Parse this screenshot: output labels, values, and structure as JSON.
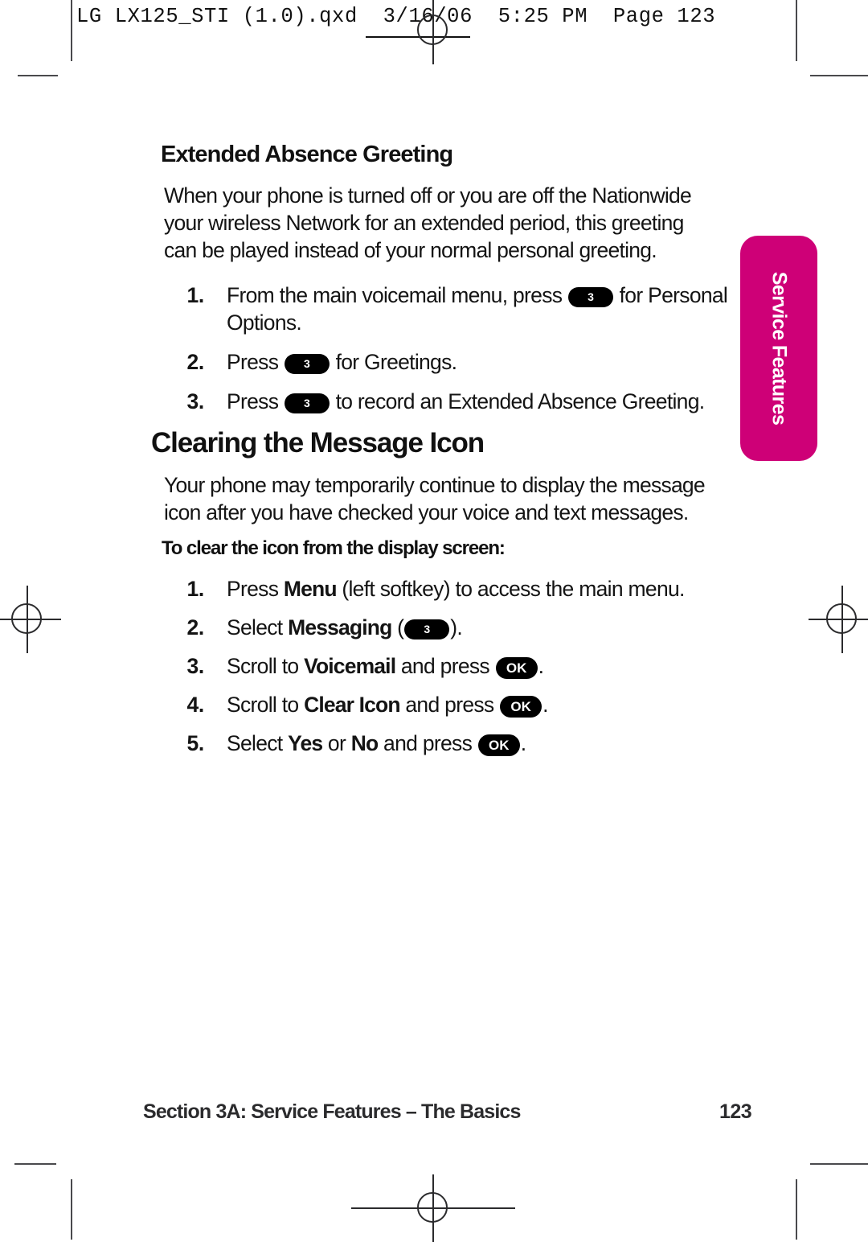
{
  "print_slug": {
    "text": "LG LX125_STI (1.0).qxd  3/16/06  5:25 PM  Page 123"
  },
  "side_tab": {
    "label": "Service Features",
    "color": "#ce0077"
  },
  "sections": [
    {
      "heading": "Extended Absence Greeting",
      "paragraph_lines": [
        "When your phone is turned off or you are off the Nationwide",
        "your wireless Network for an extended period, this greeting",
        "can be played instead of your normal personal greeting."
      ],
      "steps": [
        {
          "number": "1.",
          "pre": "From the main voicemail menu, press ",
          "key": "3",
          "post": " for Personal",
          "continuation": "Options."
        },
        {
          "number": "2.",
          "pre": "Press ",
          "key": "3",
          "post": " for Greetings."
        },
        {
          "number": "3.",
          "pre": "Press ",
          "key": "3",
          "post": " to record an Extended Absence Greeting."
        }
      ]
    },
    {
      "heading": "Clearing the Message Icon",
      "paragraph_lines": [
        "Your phone may temporarily continue to display the message",
        "icon after you have checked your voice and text messages."
      ],
      "subheading": "To clear the icon from the display screen:",
      "steps": [
        {
          "number": "1.",
          "pre": "Press ",
          "bold1": "Menu",
          "post": " (left softkey) to access the main menu."
        },
        {
          "number": "2.",
          "pre": "Select ",
          "bold1": "Messaging",
          "mid": " (",
          "key": "3",
          "post": ")."
        },
        {
          "number": "3.",
          "pre": "Scroll to ",
          "bold1": "Voicemail",
          "mid": " and press ",
          "key": "OK",
          "post": "."
        },
        {
          "number": "4.",
          "pre": "Scroll to ",
          "bold1": "Clear Icon",
          "mid": " and press ",
          "key": "OK",
          "post": "."
        },
        {
          "number": "5.",
          "pre": "Select ",
          "bold1": "Yes",
          "mid1": " or ",
          "bold2": "No",
          "mid": " and press ",
          "key": "OK",
          "post": "."
        }
      ]
    }
  ],
  "footer": {
    "left": "Section 3A: Service Features – The Basics",
    "page_number": "123"
  }
}
